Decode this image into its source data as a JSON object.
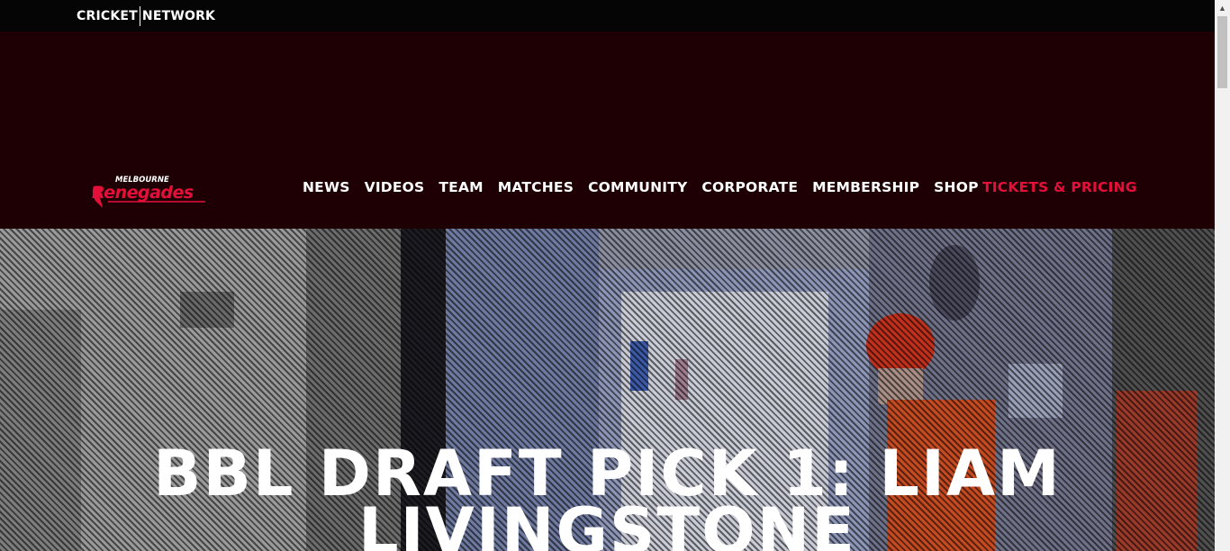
{
  "network_bar": {
    "logo_left": "CRICKET",
    "logo_right": "NETWORK"
  },
  "header": {
    "club_logo": {
      "line1": "MELBOURNE",
      "line2": "Renegades",
      "color": "#e5103a"
    },
    "nav": [
      "NEWS",
      "VIDEOS",
      "TEAM",
      "MATCHES",
      "COMMUNITY",
      "CORPORATE",
      "MEMBERSHIP",
      "SHOP"
    ],
    "tickets_label": "TICKETS & PRICING"
  },
  "hero": {
    "title": "BBL DRAFT PICK 1: LIAM LIVINGSTONE"
  },
  "colors": {
    "header_bg": "#1e0004",
    "network_bg": "#050505",
    "accent": "#e5103a"
  }
}
